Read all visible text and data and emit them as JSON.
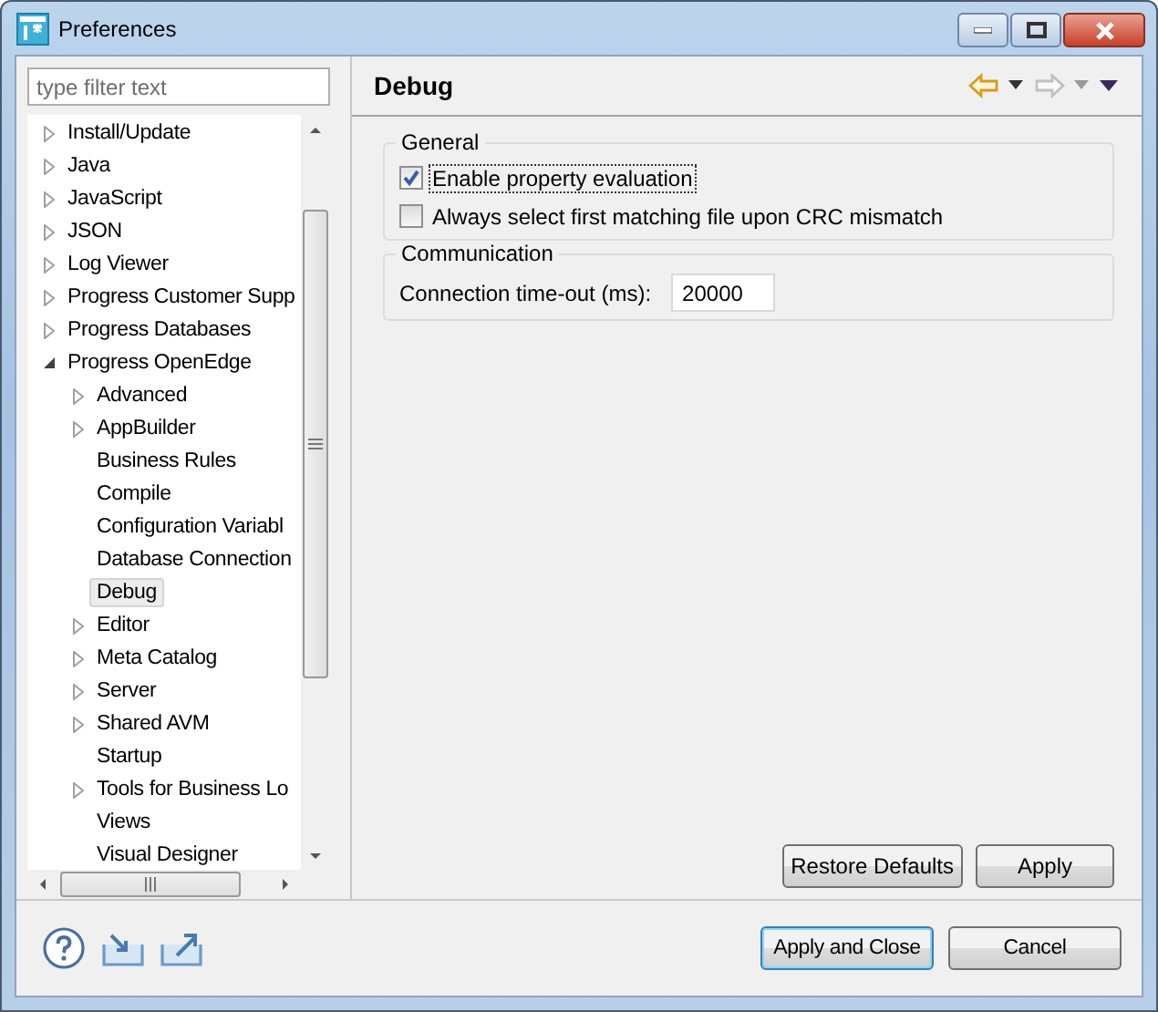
{
  "window": {
    "title": "Preferences"
  },
  "filter": {
    "placeholder": "type filter text"
  },
  "tree": [
    {
      "label": "Install/Update",
      "kind": "folder",
      "expanded": false,
      "selected": false
    },
    {
      "label": "Java",
      "kind": "folder",
      "expanded": false,
      "selected": false
    },
    {
      "label": "JavaScript",
      "kind": "folder",
      "expanded": false,
      "selected": false
    },
    {
      "label": "JSON",
      "kind": "folder",
      "expanded": false,
      "selected": false
    },
    {
      "label": "Log Viewer",
      "kind": "folder",
      "expanded": false,
      "selected": false
    },
    {
      "label": "Progress Customer Supp",
      "kind": "folder",
      "expanded": false,
      "selected": false
    },
    {
      "label": "Progress Databases",
      "kind": "folder",
      "expanded": false,
      "selected": false
    },
    {
      "label": "Progress OpenEdge",
      "kind": "folder",
      "expanded": true,
      "selected": false,
      "children": [
        {
          "label": "Advanced",
          "kind": "folder",
          "expanded": false,
          "selected": false
        },
        {
          "label": "AppBuilder",
          "kind": "folder",
          "expanded": false,
          "selected": false
        },
        {
          "label": "Business Rules",
          "kind": "leaf",
          "selected": false
        },
        {
          "label": "Compile",
          "kind": "leaf",
          "selected": false
        },
        {
          "label": "Configuration Variabl",
          "kind": "leaf",
          "selected": false
        },
        {
          "label": "Database Connection",
          "kind": "leaf",
          "selected": false
        },
        {
          "label": "Debug",
          "kind": "leaf",
          "selected": true
        },
        {
          "label": "Editor",
          "kind": "folder",
          "expanded": false,
          "selected": false
        },
        {
          "label": "Meta Catalog",
          "kind": "folder",
          "expanded": false,
          "selected": false
        },
        {
          "label": "Server",
          "kind": "folder",
          "expanded": false,
          "selected": false
        },
        {
          "label": "Shared AVM",
          "kind": "folder",
          "expanded": false,
          "selected": false
        },
        {
          "label": "Startup",
          "kind": "leaf",
          "selected": false
        },
        {
          "label": "Tools for Business Lo",
          "kind": "folder",
          "expanded": false,
          "selected": false
        },
        {
          "label": "Views",
          "kind": "leaf",
          "selected": false
        },
        {
          "label": "Visual Designer",
          "kind": "leaf",
          "selected": false
        }
      ]
    }
  ],
  "page": {
    "title": "Debug",
    "groups": [
      {
        "title": "General",
        "options": [
          {
            "kind": "checkbox",
            "label": "Enable property evaluation",
            "checked": true,
            "focused": true
          },
          {
            "kind": "checkbox",
            "label": "Always select first matching file upon CRC mismatch",
            "checked": false,
            "focused": false
          }
        ]
      },
      {
        "title": "Communication",
        "options": [
          {
            "kind": "field",
            "label": "Connection time-out (ms):",
            "value": "20000"
          }
        ]
      }
    ],
    "buttons": [
      "Restore Defaults",
      "Apply"
    ]
  },
  "dialog_buttons": [
    {
      "label": "Apply and Close",
      "default": true
    },
    {
      "label": "Cancel",
      "default": false
    }
  ]
}
